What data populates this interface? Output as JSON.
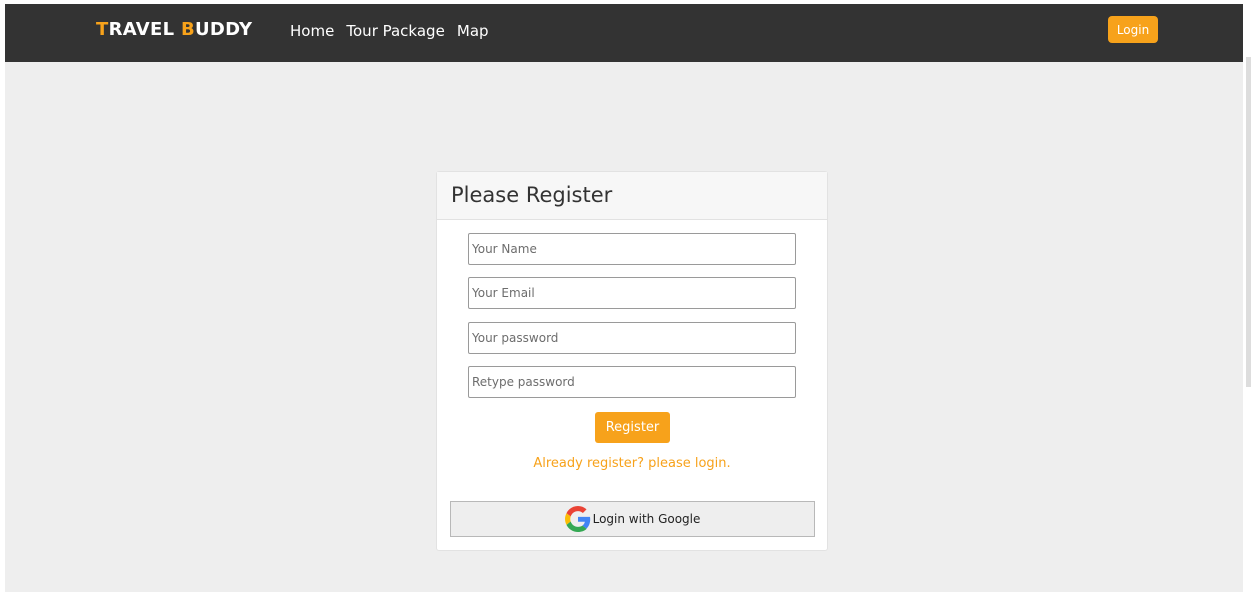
{
  "brand": {
    "first_letter": "T",
    "first_rest": "RAVEL ",
    "second_letter": "B",
    "second_rest": "UDDY"
  },
  "nav": {
    "links": [
      {
        "label": "Home"
      },
      {
        "label": "Tour Package"
      },
      {
        "label": "Map"
      }
    ],
    "login_label": "Login"
  },
  "form": {
    "title": "Please Register",
    "fields": [
      {
        "placeholder": "Your Name",
        "value": ""
      },
      {
        "placeholder": "Your Email",
        "value": ""
      },
      {
        "placeholder": "Your password",
        "value": ""
      },
      {
        "placeholder": "Retype password",
        "value": ""
      }
    ],
    "register_label": "Register",
    "login_link": "Already register? please login.",
    "google_label": "Login with Google"
  },
  "icons": {
    "google": "google-icon"
  },
  "colors": {
    "accent": "#f7a21b",
    "navbar_bg": "#333333",
    "page_bg": "#eeeeee"
  }
}
